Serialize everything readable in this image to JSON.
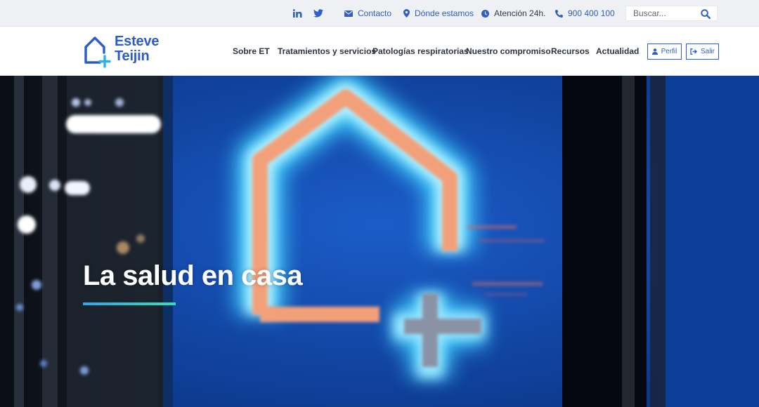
{
  "topbar": {
    "social": [
      "linkedin-icon",
      "twitter-icon"
    ],
    "contact_label": "Contacto",
    "location_label": "Dónde estamos",
    "hours_label": "Atención 24h.",
    "phone_label": "900 400 100",
    "search_placeholder": "Buscar..."
  },
  "logo": {
    "line1": "Esteve",
    "line2": "Teijin"
  },
  "nav": {
    "items": [
      "Sobre ET",
      "Tratamientos y servicios",
      "Patologías respiratorias",
      "Nuestro compromiso",
      "Recursos",
      "Actualidad"
    ]
  },
  "account": {
    "profile_label": "Perfil",
    "logout_label": "Salir"
  },
  "hero": {
    "title": "La salud en casa"
  },
  "colors": {
    "brand": "#2c5cc5",
    "link": "#2f5fc4",
    "hero_bg": "#0c3a8a",
    "accent_start": "#2ea6ef",
    "accent_end": "#34e0b0"
  }
}
